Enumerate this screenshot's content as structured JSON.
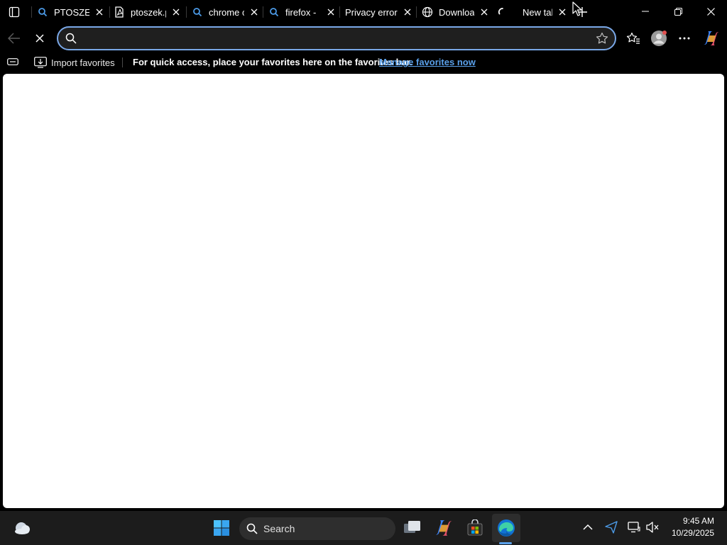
{
  "tabs": [
    {
      "title": "PTOSZEK",
      "favicon": "search-icon"
    },
    {
      "title": "ptoszek.p",
      "favicon": "pdf-icon"
    },
    {
      "title": "chrome c",
      "favicon": "search-icon"
    },
    {
      "title": "firefox -",
      "favicon": "search-icon"
    },
    {
      "title": "Privacy error",
      "favicon": "warning-icon"
    },
    {
      "title": "Downloa",
      "favicon": "globe-icon"
    },
    {
      "title": "New tab",
      "favicon": "loading-icon",
      "active": true
    }
  ],
  "address_bar": {
    "value": "",
    "placeholder": ""
  },
  "favorites_bar": {
    "import_label": "Import favorites",
    "hint": "For quick access, place your favorites here on the favorites bar.",
    "manage_link": "Manage favorites now"
  },
  "taskbar": {
    "search_label": "Search",
    "time": "9:45 AM",
    "date": "10/29/2025",
    "icons": [
      "weather-icon",
      "windows-start-icon",
      "search-icon",
      "task-view-icon",
      "copilot-icon",
      "microsoft-store-icon",
      "edge-icon",
      "chevron-up-icon",
      "send-icon",
      "display-icon",
      "speaker-muted-icon"
    ]
  },
  "colors": {
    "accent": "#5aa0ea",
    "address_border": "#7aa8e8",
    "background": "#000000",
    "content": "#ffffff"
  }
}
